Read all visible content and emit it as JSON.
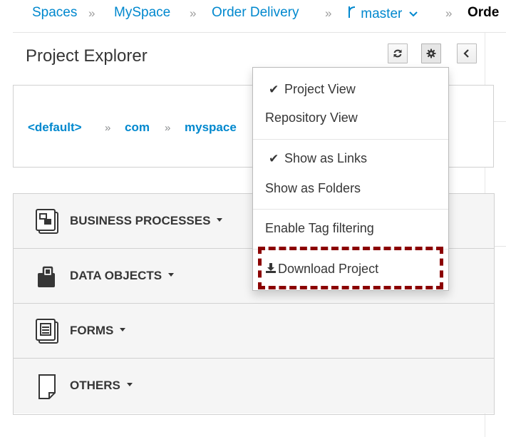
{
  "breadcrumb": {
    "items": [
      "Spaces",
      "MySpace",
      "Order Delivery",
      "master",
      "Orde"
    ],
    "separator": "»",
    "branch_icon": "branch-icon",
    "branch_caret": "⌄"
  },
  "explorer": {
    "title": "Project Explorer",
    "buttons": {
      "refresh_icon": "refresh-icon",
      "settings_icon": "gear-icon",
      "collapse_icon": "chevron-left-icon"
    }
  },
  "package_path": {
    "items": [
      "<default>",
      "com",
      "myspace"
    ],
    "separator": "»"
  },
  "categories": [
    {
      "label": "BUSINESS PROCESSES",
      "icon": "business-process-icon"
    },
    {
      "label": "DATA OBJECTS",
      "icon": "data-object-icon"
    },
    {
      "label": "FORMS",
      "icon": "form-icon"
    },
    {
      "label": "OTHERS",
      "icon": "document-icon"
    }
  ],
  "menu": {
    "check": "✔",
    "items": {
      "project_view": "Project View",
      "repository_view": "Repository View",
      "show_as_links": "Show as Links",
      "show_as_folders": "Show as Folders",
      "enable_tag_filtering": "Enable Tag filtering",
      "download_project": "Download Project"
    },
    "download_icon": "download-icon"
  },
  "colors": {
    "link": "#0088ce",
    "highlight": "#8b0000"
  }
}
